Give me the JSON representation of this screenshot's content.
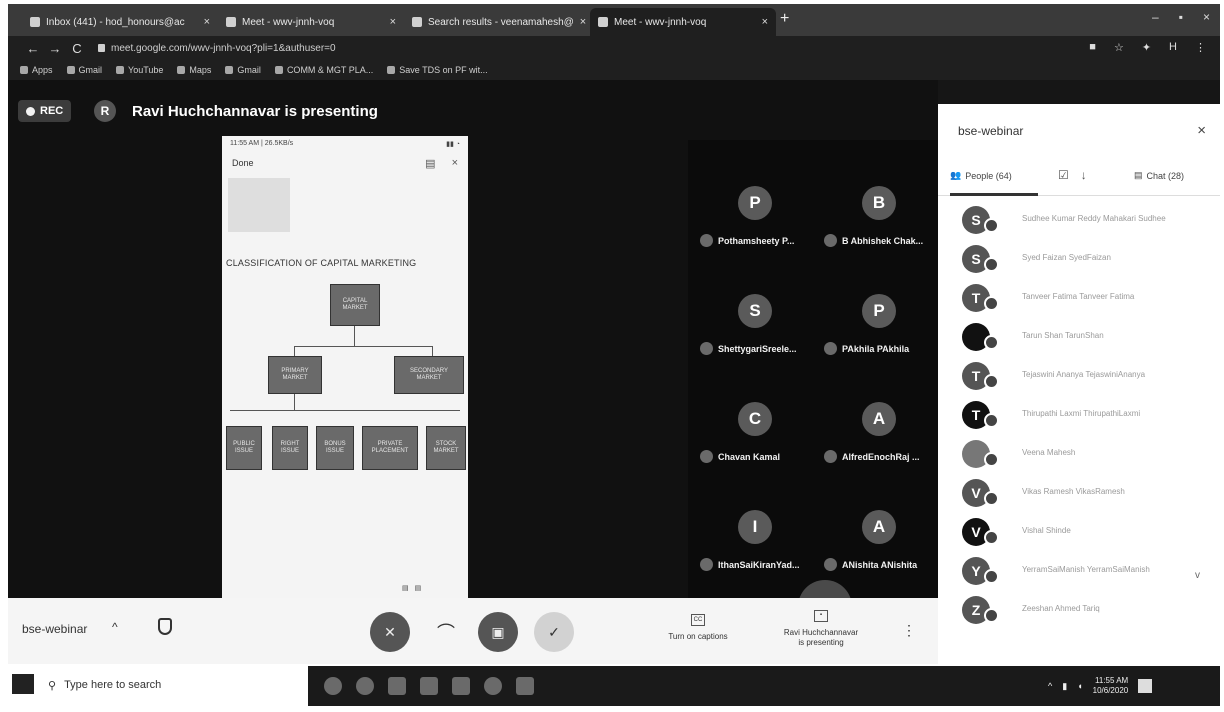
{
  "browser": {
    "tabs": [
      {
        "title": "Inbox (441) - hod_honours@ac",
        "active": false
      },
      {
        "title": "Meet - wwv-jnnh-voq",
        "active": true
      },
      {
        "title": "Search results - veenamahesh@",
        "active": false
      },
      {
        "title": "Meet - wwv-jnnh-voq",
        "active": false
      }
    ],
    "url": "meet.google.com/wwv-jnnh-voq?pli=1&authuser=0",
    "bookmarks": [
      "Apps",
      "Gmail",
      "YouTube",
      "Maps",
      "Gmail",
      "COMM & MGT PLA...",
      "Save TDS on PF wit..."
    ]
  },
  "meet": {
    "rec_label": "REC",
    "presenter_initial": "R",
    "presenting_text": "Ravi Huchchannavar is presenting",
    "shared_screen": {
      "status_time": "11:55 AM | 26.5KB/s",
      "done_label": "Done",
      "title": "CLASSIFICATION OF CAPITAL MARKETING",
      "root": "CAPITAL MARKET",
      "level1": [
        "PRIMARY MARKET",
        "SECONDARY MARKET"
      ],
      "level2": [
        "PUBLIC ISSUE",
        "RIGHT ISSUE",
        "BONUS ISSUE",
        "PRIVATE PLACEMENT",
        "STOCK MARKET"
      ]
    },
    "tiles": [
      {
        "initial": "P",
        "name": "Pothamsheety P..."
      },
      {
        "initial": "B",
        "name": "B Abhishek Chak..."
      },
      {
        "initial": "S",
        "name": "ShettygariSreele..."
      },
      {
        "initial": "P",
        "name": "PAkhila PAkhila"
      },
      {
        "initial": "C",
        "name": "Chavan Kamal"
      },
      {
        "initial": "A",
        "name": "AlfredEnochRaj ..."
      },
      {
        "initial": "I",
        "name": "IthanSaiKiranYad..."
      },
      {
        "initial": "A",
        "name": "ANishita ANishita"
      }
    ],
    "bottom_bar": {
      "meeting_name": "bse-webinar",
      "captions_label": "Turn on captions",
      "presenting_line1": "Ravi Huchchannavar",
      "presenting_line2": "is presenting"
    }
  },
  "panel": {
    "title": "bse-webinar",
    "people_tab": "People (64)",
    "chat_tab": "Chat (28)",
    "people": [
      {
        "initial": "S",
        "name": "Sudhee Kumar Reddy Mahakari Sudhee"
      },
      {
        "initial": "S",
        "name": "Syed Faizan SyedFaizan"
      },
      {
        "initial": "T",
        "name": "Tanveer Fatima Tanveer Fatima"
      },
      {
        "initial": "",
        "name": "Tarun Shan TarunShan"
      },
      {
        "initial": "T",
        "name": "Tejaswini Ananya TejaswiniAnanya"
      },
      {
        "initial": "T",
        "name": "Thirupathi Laxmi ThirupathiLaxmi"
      },
      {
        "initial": "",
        "name": "Veena Mahesh"
      },
      {
        "initial": "V",
        "name": "Vikas Ramesh VikasRamesh"
      },
      {
        "initial": "V",
        "name": "Vishal Shinde"
      },
      {
        "initial": "Y",
        "name": "YerramSaiManish YerramSaiManish"
      },
      {
        "initial": "Z",
        "name": "Zeeshan Ahmed Tariq"
      }
    ]
  },
  "taskbar": {
    "search_placeholder": "Type here to search",
    "time": "11:55 AM",
    "date": "10/6/2020"
  }
}
